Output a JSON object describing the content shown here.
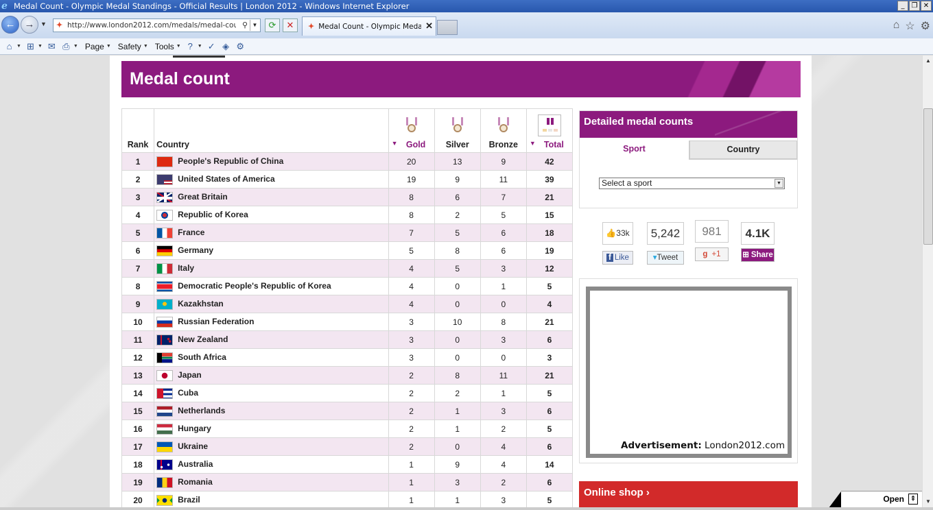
{
  "window": {
    "title": "Medal Count - Olympic Medal Standings - Official Results | London 2012 - Windows Internet Explorer",
    "buttons": [
      "_",
      "❐",
      "✕"
    ]
  },
  "browser": {
    "url": "http://www.london2012.com/medals/medal-count/",
    "tab_label": "Medal Count - Olympic Medal...",
    "menus": {
      "page": "Page",
      "safety": "Safety",
      "tools": "Tools"
    }
  },
  "page": {
    "banner_title": "Medal count",
    "table": {
      "headers": {
        "rank": "Rank",
        "country": "Country",
        "gold": "Gold",
        "silver": "Silver",
        "bronze": "Bronze",
        "total": "Total"
      },
      "rows": [
        {
          "rank": "1",
          "country": "People's Republic of China",
          "gold": "20",
          "silver": "13",
          "bronze": "9",
          "total": "42",
          "flag": "china"
        },
        {
          "rank": "2",
          "country": "United States of America",
          "gold": "19",
          "silver": "9",
          "bronze": "11",
          "total": "39",
          "flag": "usa"
        },
        {
          "rank": "3",
          "country": "Great Britain",
          "gold": "8",
          "silver": "6",
          "bronze": "7",
          "total": "21",
          "flag": "gbr"
        },
        {
          "rank": "4",
          "country": "Republic of Korea",
          "gold": "8",
          "silver": "2",
          "bronze": "5",
          "total": "15",
          "flag": "kor"
        },
        {
          "rank": "5",
          "country": "France",
          "gold": "7",
          "silver": "5",
          "bronze": "6",
          "total": "18",
          "flag": "fra"
        },
        {
          "rank": "6",
          "country": "Germany",
          "gold": "5",
          "silver": "8",
          "bronze": "6",
          "total": "19",
          "flag": "ger"
        },
        {
          "rank": "7",
          "country": "Italy",
          "gold": "4",
          "silver": "5",
          "bronze": "3",
          "total": "12",
          "flag": "ita"
        },
        {
          "rank": "8",
          "country": "Democratic People's Republic of Korea",
          "gold": "4",
          "silver": "0",
          "bronze": "1",
          "total": "5",
          "flag": "prk"
        },
        {
          "rank": "9",
          "country": "Kazakhstan",
          "gold": "4",
          "silver": "0",
          "bronze": "0",
          "total": "4",
          "flag": "kaz"
        },
        {
          "rank": "10",
          "country": "Russian Federation",
          "gold": "3",
          "silver": "10",
          "bronze": "8",
          "total": "21",
          "flag": "rus"
        },
        {
          "rank": "11",
          "country": "New Zealand",
          "gold": "3",
          "silver": "0",
          "bronze": "3",
          "total": "6",
          "flag": "nzl"
        },
        {
          "rank": "12",
          "country": "South Africa",
          "gold": "3",
          "silver": "0",
          "bronze": "0",
          "total": "3",
          "flag": "rsa"
        },
        {
          "rank": "13",
          "country": "Japan",
          "gold": "2",
          "silver": "8",
          "bronze": "11",
          "total": "21",
          "flag": "jpn"
        },
        {
          "rank": "14",
          "country": "Cuba",
          "gold": "2",
          "silver": "2",
          "bronze": "1",
          "total": "5",
          "flag": "cub"
        },
        {
          "rank": "15",
          "country": "Netherlands",
          "gold": "2",
          "silver": "1",
          "bronze": "3",
          "total": "6",
          "flag": "ned"
        },
        {
          "rank": "16",
          "country": "Hungary",
          "gold": "2",
          "silver": "1",
          "bronze": "2",
          "total": "5",
          "flag": "hun"
        },
        {
          "rank": "17",
          "country": "Ukraine",
          "gold": "2",
          "silver": "0",
          "bronze": "4",
          "total": "6",
          "flag": "ukr"
        },
        {
          "rank": "18",
          "country": "Australia",
          "gold": "1",
          "silver": "9",
          "bronze": "4",
          "total": "14",
          "flag": "aus"
        },
        {
          "rank": "19",
          "country": "Romania",
          "gold": "1",
          "silver": "3",
          "bronze": "2",
          "total": "6",
          "flag": "rou"
        },
        {
          "rank": "20",
          "country": "Brazil",
          "gold": "1",
          "silver": "1",
          "bronze": "3",
          "total": "5",
          "flag": "bra"
        }
      ]
    },
    "detailed": {
      "title": "Detailed medal counts",
      "tab_sport": "Sport",
      "tab_country": "Country",
      "select_value": "Select a sport"
    },
    "social": {
      "fb_count": "33k",
      "fb_label": "Like",
      "tw_count": "5,242",
      "tw_label": "Tweet",
      "gp_count": "981",
      "gp_label": "+1",
      "share_count": "4.1K",
      "share_label": "Share"
    },
    "ad": {
      "label": "Advertisement:",
      "source": "London2012.com"
    },
    "shop": {
      "title": "Online shop ›"
    },
    "open_bar": {
      "label": "Open"
    }
  },
  "colors": {
    "brand_purple": "#8c1a7e",
    "shop_red": "#d22a2a",
    "row_tint": "#f3e6f1"
  }
}
